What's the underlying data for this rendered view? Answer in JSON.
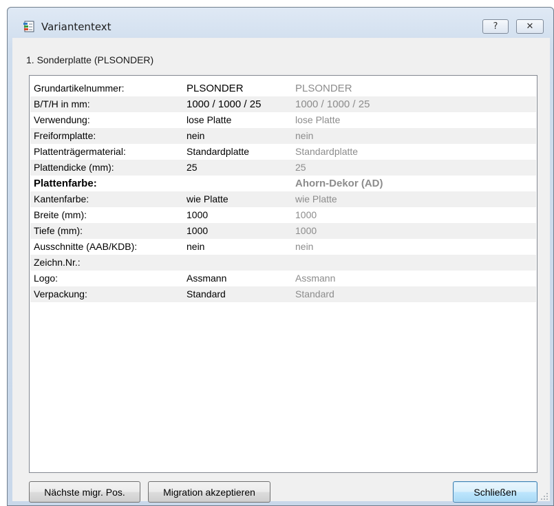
{
  "window": {
    "title": "Variantentext",
    "help_glyph": "?",
    "close_glyph": "✕",
    "icon": "form-document-icon"
  },
  "section_label": "1. Sonderplatte (PLSONDER)",
  "rows": [
    {
      "label": "Grundartikelnummer:",
      "value": "PLSONDER",
      "migrated": "PLSONDER"
    },
    {
      "label": "B/T/H in mm:",
      "value": "1000 / 1000 / 25",
      "migrated": "1000 / 1000 / 25"
    },
    {
      "label": "Verwendung:",
      "value": "lose Platte",
      "migrated": "lose Platte"
    },
    {
      "label": "Freiformplatte:",
      "value": "nein",
      "migrated": "nein"
    },
    {
      "label": "Plattenträgermaterial:",
      "value": "Standardplatte",
      "migrated": "Standardplatte"
    },
    {
      "label": "Plattendicke (mm):",
      "value": "25",
      "migrated": "25"
    },
    {
      "label": "Plattenfarbe:",
      "value": "",
      "migrated": "Ahorn-Dekor (AD)"
    },
    {
      "label": "Kantenfarbe:",
      "value": "wie Platte",
      "migrated": "wie Platte"
    },
    {
      "label": "Breite (mm):",
      "value": "1000",
      "migrated": "1000"
    },
    {
      "label": "Tiefe (mm):",
      "value": "1000",
      "migrated": "1000"
    },
    {
      "label": "Ausschnitte (AAB/KDB):",
      "value": "nein",
      "migrated": "nein"
    },
    {
      "label": "Zeichn.Nr.:",
      "value": "",
      "migrated": ""
    },
    {
      "label": "Logo:",
      "value": "Assmann",
      "migrated": "Assmann"
    },
    {
      "label": "Verpackung:",
      "value": "Standard",
      "migrated": "Standard"
    }
  ],
  "buttons": {
    "next_pos": "Nächste migr. Pos.",
    "accept_migration": "Migration akzeptieren",
    "close": "Schließen"
  },
  "colors": {
    "migrated_text": "#8c8c8c",
    "default_button_border": "#3c7fb1"
  }
}
